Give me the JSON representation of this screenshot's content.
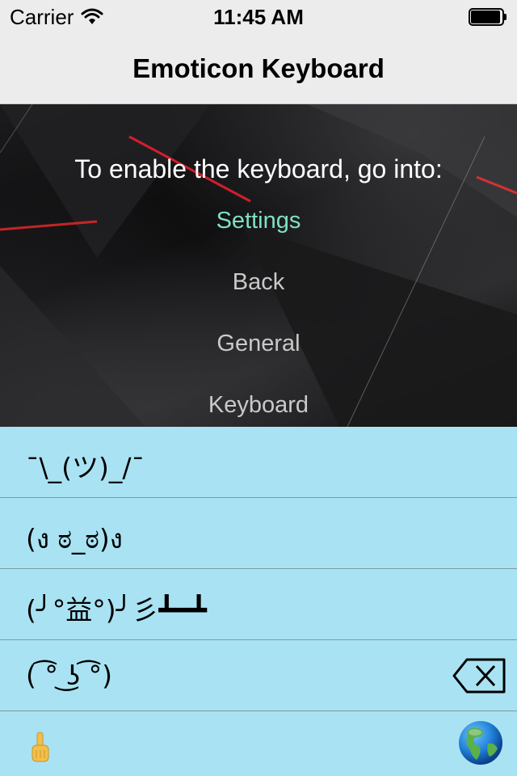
{
  "status_bar": {
    "carrier": "Carrier",
    "time": "11:45 AM",
    "wifi_icon": "wifi-icon",
    "battery_icon": "battery-icon"
  },
  "nav": {
    "title": "Emoticon Keyboard"
  },
  "instructions": {
    "heading": "To enable the keyboard, go into:",
    "steps": [
      {
        "label": "Settings",
        "active": true
      },
      {
        "label": "Back",
        "active": false
      },
      {
        "label": "General",
        "active": false
      },
      {
        "label": "Keyboard",
        "active": false
      }
    ],
    "active_color": "#7fe0c4"
  },
  "keyboard": {
    "emoticons": [
      "¯\\_(ツ)_/¯",
      "(ง ಠ_ಠ)ง",
      "(╯°益°)╯彡┻━┻",
      "( ͡° ͜ʖ ͡°)"
    ],
    "backspace_icon": "backspace-icon",
    "bottom_left_icon": "pointing-finger-icon",
    "bottom_right_icon": "globe-icon",
    "background_color": "#a9e3f3"
  }
}
